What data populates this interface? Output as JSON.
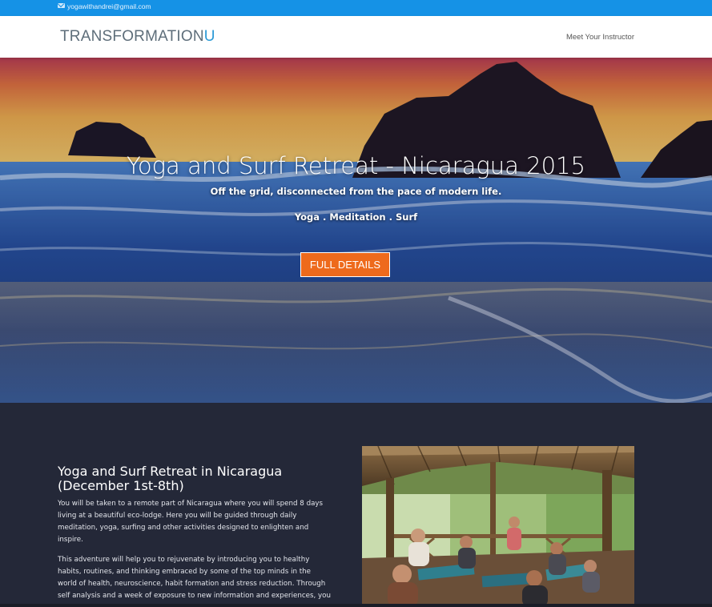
{
  "topbar": {
    "email": "yogawithandrei@gmail.com",
    "email_icon": "envelope-icon",
    "background": "#1592e6"
  },
  "header": {
    "logo_main": "TRANSFORMATION",
    "logo_accent": "U",
    "nav": [
      "Meet Your Instructor"
    ]
  },
  "hero": {
    "title": "Yoga and Surf Retreat - Nicaragua 2015",
    "subtitle": "Off the grid, disconnected from the pace of modern life.",
    "tags": "Yoga . Meditation . Surf",
    "button_label": "FULL DETAILS",
    "button_color": "#ee6a1c"
  },
  "content": {
    "heading": "Yoga and Surf Retreat in Nicaragua (December 1st-8th)",
    "paragraph1": "You will be taken to a remote part of Nicaragua where you will spend 8 days living at a beautiful eco-lodge. Here you will be guided through daily meditation, yoga, surfing and other activities designed to enlighten and inspire.",
    "paragraph2": "This adventure will help you to rejuvenate by introducing you to healthy habits, routines, and thinking embraced by some of the top minds in the world of health, neuroscience, habit formation and stress reduction. Through self analysis and a week of exposure to new information and experiences, you",
    "background": "#242838"
  }
}
